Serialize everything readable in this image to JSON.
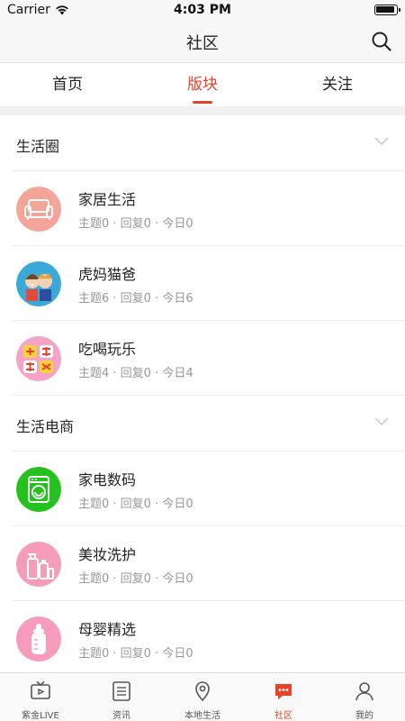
{
  "status_bar": {
    "carrier": "Carrier",
    "time": "4:03 PM"
  },
  "nav": {
    "title": "社区",
    "search_icon": "search-icon"
  },
  "tabs": [
    {
      "label": "首页",
      "active": false
    },
    {
      "label": "版块",
      "active": true
    },
    {
      "label": "关注",
      "active": false
    }
  ],
  "sections": [
    {
      "title": "生活圈",
      "items": [
        {
          "title": "家居生活",
          "stats": "主题0 · 回复0 · 今日0",
          "icon": "sofa-icon"
        },
        {
          "title": "虎妈猫爸",
          "stats": "主题6 · 回复0 · 今日6",
          "icon": "parents-icon"
        },
        {
          "title": "吃喝玩乐",
          "stats": "主题4 · 回复0 · 今日4",
          "icon": "food-fun-icon"
        }
      ]
    },
    {
      "title": "生活电商",
      "items": [
        {
          "title": "家电数码",
          "stats": "主题0 · 回复0 · 今日0",
          "icon": "washing-machine-icon"
        },
        {
          "title": "美妆洗护",
          "stats": "主题0 · 回复0 · 今日0",
          "icon": "cosmetics-icon"
        },
        {
          "title": "母婴精选",
          "stats": "主题0 · 回复0 · 今日0",
          "icon": "baby-bottle-icon"
        }
      ]
    }
  ],
  "tabbar": [
    {
      "label": "紫金LIVE",
      "icon": "tv-icon",
      "active": false
    },
    {
      "label": "资讯",
      "icon": "news-list-icon",
      "active": false
    },
    {
      "label": "本地生活",
      "icon": "location-pin-icon",
      "active": false
    },
    {
      "label": "社区",
      "icon": "chat-bubble-icon",
      "active": true
    },
    {
      "label": "我的",
      "icon": "profile-icon",
      "active": false
    }
  ],
  "colors": {
    "accent": "#e8432a",
    "divider": "#ececec",
    "muted_text": "#999999"
  }
}
